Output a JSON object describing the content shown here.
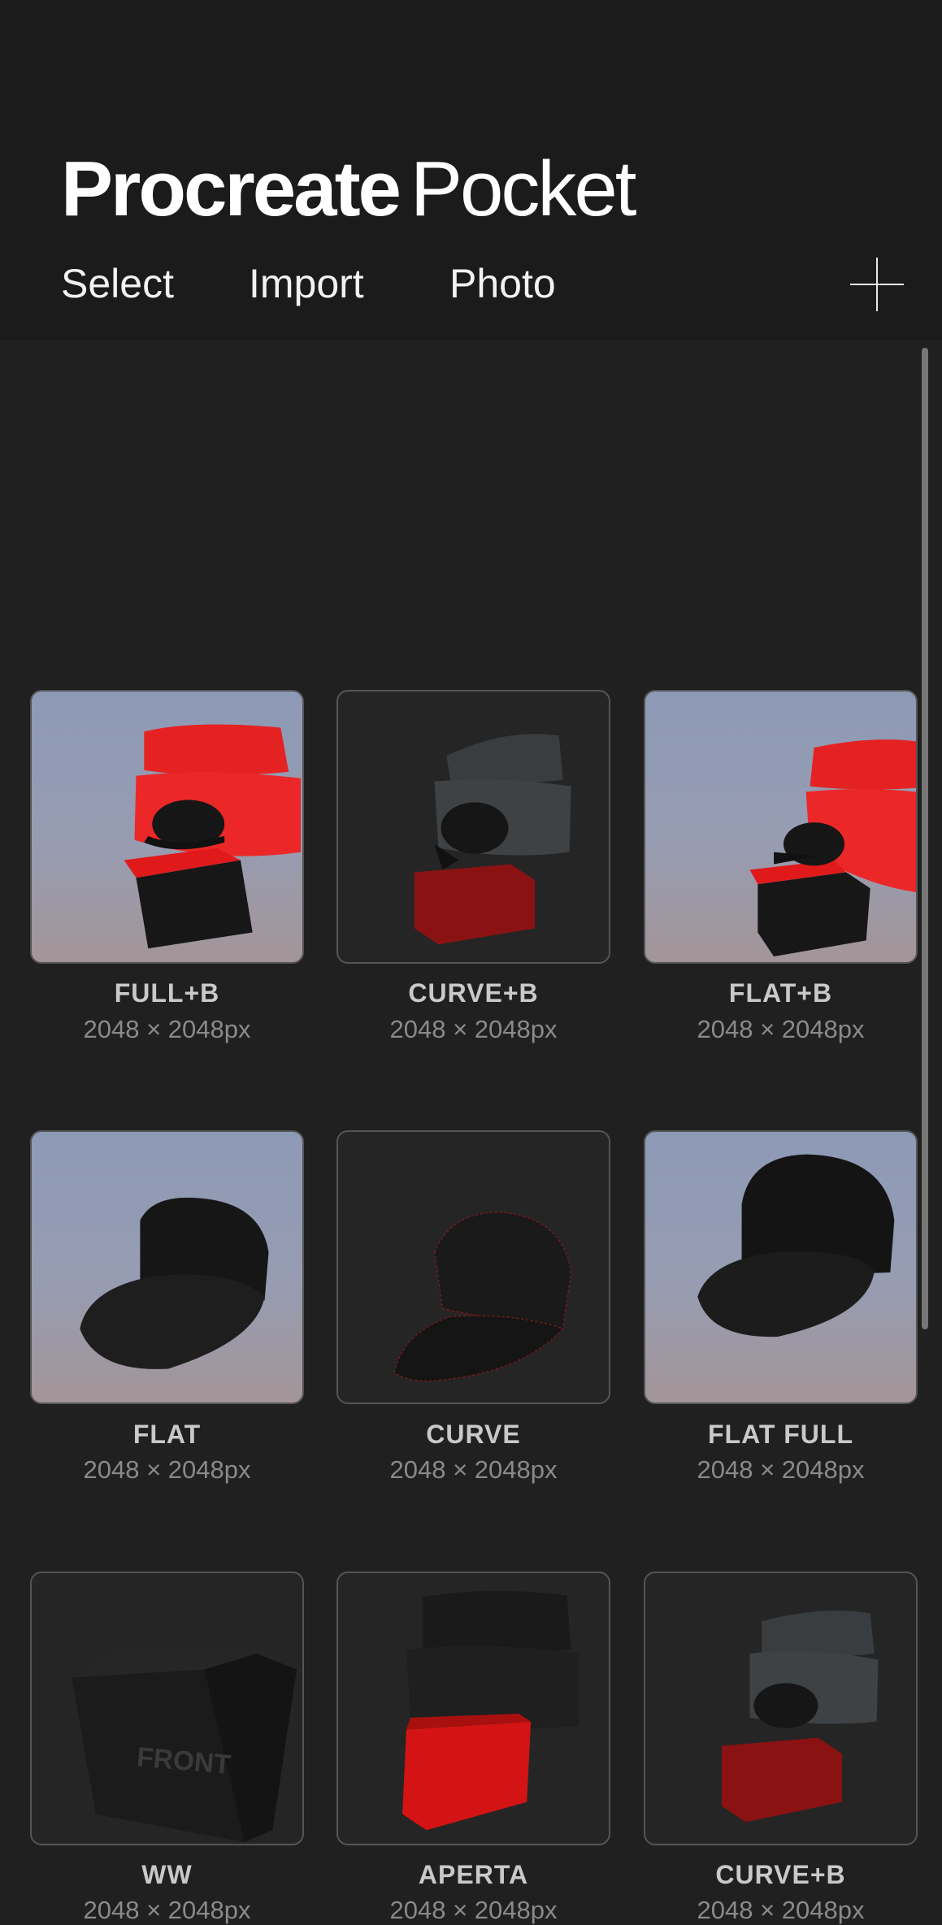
{
  "app": {
    "title_bold": "Procreate",
    "title_light": "Pocket"
  },
  "menu": {
    "select": "Select",
    "import": "Import",
    "photo": "Photo"
  },
  "icons": {
    "add": "plus-icon"
  },
  "gallery": [
    {
      "name": "FULL+B",
      "size": "2048 × 2048px"
    },
    {
      "name": "CURVE+B",
      "size": "2048 × 2048px"
    },
    {
      "name": "FLAT+B",
      "size": "2048 × 2048px"
    },
    {
      "name": "FLAT",
      "size": "2048 × 2048px"
    },
    {
      "name": "CURVE",
      "size": "2048 × 2048px"
    },
    {
      "name": "FLAT FULL",
      "size": "2048 × 2048px"
    },
    {
      "name": "WW",
      "size": "2048 × 2048px"
    },
    {
      "name": "APERTA",
      "size": "2048 × 2048px"
    },
    {
      "name": "CURVE+B",
      "size": "2048 × 2048px"
    }
  ],
  "artwork_text": {
    "box_front": "FRONT"
  },
  "colors": {
    "background": "#202020",
    "header": "#1b1b1b",
    "accent_red": "#e82020"
  }
}
